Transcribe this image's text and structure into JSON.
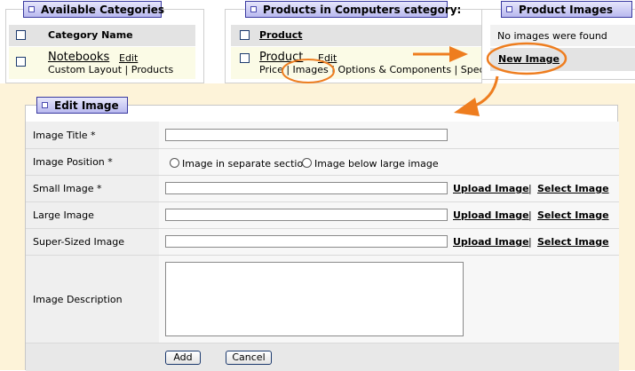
{
  "categories": {
    "panel_title": "Available Categories",
    "col_header": "Category Name",
    "row": {
      "name": "Notebooks",
      "edit": "Edit",
      "sub1": "Custom Layout",
      "sub2": "Products"
    }
  },
  "products": {
    "panel_title": "Products in Computers category:",
    "col_header": "Product",
    "row": {
      "name": "Product",
      "edit": "Edit",
      "sub1": "Price",
      "sub2": "Images",
      "sub3": "Options & Components",
      "sub4": "Specificat"
    }
  },
  "images": {
    "panel_title": "Product Images",
    "empty_text": "No images were found",
    "new_link": "New Image"
  },
  "form": {
    "title": "Edit Image",
    "fields": [
      {
        "label": "Image Title *"
      },
      {
        "label": "Image Position *"
      },
      {
        "label": "Small Image *"
      },
      {
        "label": "Large Image"
      },
      {
        "label": "Super-Sized Image"
      },
      {
        "label": "Image Description"
      }
    ],
    "position_options": [
      "Image in separate section",
      "Image below large image"
    ],
    "upload_label": "Upload Image",
    "divider": "|",
    "select_label": "Select Image",
    "add_button": "Add",
    "cancel_button": "Cancel"
  },
  "colors": {
    "annotation": "#ee7d1f",
    "panel_border": "#3a3aa0",
    "form_bg": "#fdf3d9"
  }
}
